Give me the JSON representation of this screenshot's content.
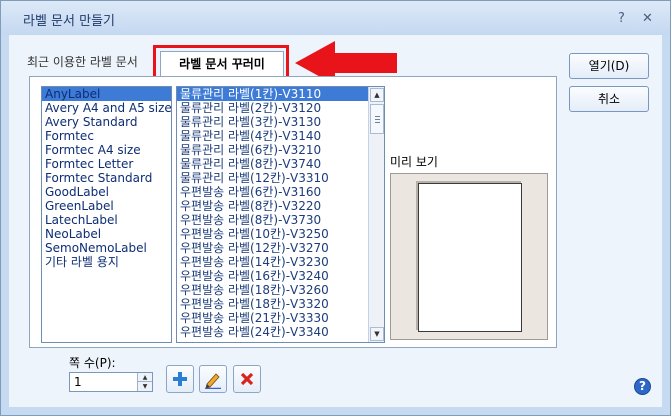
{
  "window": {
    "title": "라벨 문서 만들기",
    "help_glyph": "?",
    "close_glyph": "✕"
  },
  "tabs": {
    "recent_label": "최근 이용한 라벨 문서",
    "decorate_label": "라벨 문서 꾸러미"
  },
  "accent_colors": {
    "annotation_red": "#e8141a",
    "selection_blue": "#3d7bd6"
  },
  "brands": {
    "items": [
      "AnyLabel",
      "Avery A4 and A5 size",
      "Avery Standard",
      "Formtec",
      "Formtec A4 size",
      "Formtec Letter",
      "Formtec Standard",
      "GoodLabel",
      "GreenLabel",
      "LatechLabel",
      "NeoLabel",
      "SemoNemoLabel",
      "기타 라벨 용지"
    ],
    "selected": "AnyLabel"
  },
  "products": {
    "items": [
      "물류관리 라벨(1칸)-V3110",
      "물류관리 라벨(2칸)-V3120",
      "물류관리 라벨(3칸)-V3130",
      "물류관리 라벨(4칸)-V3140",
      "물류관리 라벨(6칸)-V3210",
      "물류관리 라벨(8칸)-V3740",
      "물류관리 라벨(12칸)-V3310",
      "우편발송 라벨(6칸)-V3160",
      "우편발송 라벨(8칸)-V3220",
      "우편발송 라벨(8칸)-V3730",
      "우편발송 라벨(10칸)-V3250",
      "우편발송 라벨(12칸)-V3270",
      "우편발송 라벨(14칸)-V3230",
      "우편발송 라벨(16칸)-V3240",
      "우편발송 라벨(18칸)-V3260",
      "우편발송 라벨(18칸)-V3320",
      "우편발송 라벨(21칸)-V3330",
      "우편발송 라벨(24칸)-V3340"
    ],
    "selected": "물류관리 라벨(1칸)-V3110"
  },
  "preview": {
    "label": "미리 보기"
  },
  "buttons": {
    "open": "열기(D)",
    "cancel": "취소"
  },
  "columns": {
    "label": "쪽 수(P):",
    "value": "1"
  },
  "icons": {
    "add": "plus-icon",
    "edit": "pencil-icon",
    "delete": "x-icon",
    "help": "help-icon"
  }
}
